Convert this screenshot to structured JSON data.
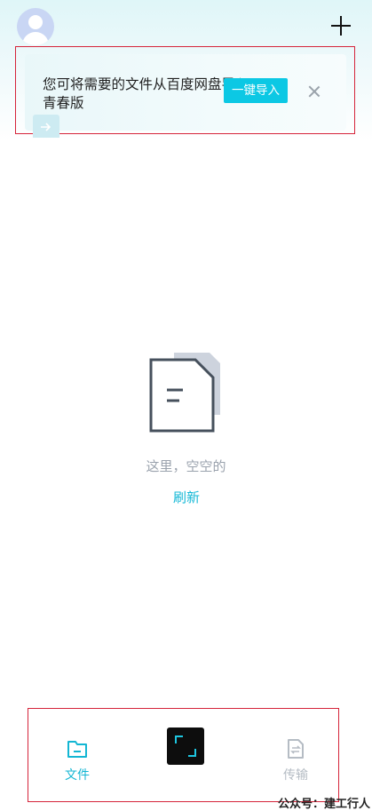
{
  "banner": {
    "message": "您可将需要的文件从百度网盘导入青春版",
    "import_label": "一键导入"
  },
  "empty_state": {
    "message": "这里，空空的",
    "refresh_label": "刷新"
  },
  "tabbar": {
    "files_label": "文件",
    "transfer_label": "传输"
  },
  "watermark": "公众号：建工行人",
  "colors": {
    "accent": "#13b6d3",
    "import_button": "#0cc8e4",
    "highlight_box": "#d5243a"
  },
  "icons": {
    "avatar": "user-avatar-icon",
    "add": "plus-icon",
    "close": "close-icon",
    "empty": "empty-document-icon",
    "files": "folder-icon",
    "scan": "scan-icon",
    "transfer": "transfer-icon"
  }
}
